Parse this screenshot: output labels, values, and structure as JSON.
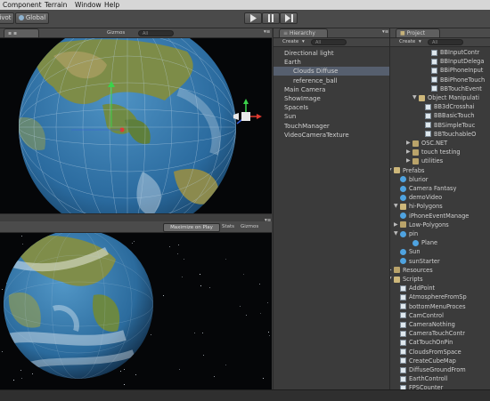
{
  "menubar": {
    "items": [
      "Component",
      "Terrain",
      "Window",
      "Help"
    ]
  },
  "toolbar": {
    "left_buttons": [
      "ivot",
      "Global"
    ],
    "play_icon": "play-icon",
    "pause_icon": "pause-icon",
    "step_icon": "step-icon"
  },
  "scene_panel": {
    "gizmos_label": "Gizmos",
    "search_placeholder": "All"
  },
  "game_panel": {
    "maximize_label": "Maximize on Play",
    "stats_label": "Stats",
    "gizmos_label": "Gizmos"
  },
  "hierarchy": {
    "tab_label": "Hierarchy",
    "create_label": "Create",
    "search_placeholder": "All",
    "items": [
      {
        "label": "Directional light",
        "indent": 0
      },
      {
        "label": "Earth",
        "indent": 0
      },
      {
        "label": "Clouds Diffuse",
        "indent": 1,
        "selected": true
      },
      {
        "label": "reference_ball",
        "indent": 1
      },
      {
        "label": "Main Camera",
        "indent": 0
      },
      {
        "label": "ShowImage",
        "indent": 0
      },
      {
        "label": "SpaceIs",
        "indent": 0
      },
      {
        "label": "Sun",
        "indent": 0
      },
      {
        "label": "TouchManager",
        "indent": 0
      },
      {
        "label": "VideoCameraTexture",
        "indent": 0
      }
    ]
  },
  "project": {
    "tab_label": "Project",
    "create_label": "Create",
    "search_placeholder": "All",
    "rows": [
      {
        "label": "BBInputContr",
        "indent": 6,
        "icon": "script"
      },
      {
        "label": "BBInputDelega",
        "indent": 6,
        "icon": "script"
      },
      {
        "label": "BBiPhoneInput",
        "indent": 6,
        "icon": "script"
      },
      {
        "label": "BBiPhoneTouch",
        "indent": 6,
        "icon": "script"
      },
      {
        "label": "BBTouchEvent",
        "indent": 6,
        "icon": "script"
      },
      {
        "label": "Object Manipulati",
        "indent": 4,
        "icon": "folder-open",
        "arrow": "▼"
      },
      {
        "label": "BB3dCrosshai",
        "indent": 5,
        "icon": "script"
      },
      {
        "label": "BBBasicTouch",
        "indent": 5,
        "icon": "script"
      },
      {
        "label": "BBSimpleTouc",
        "indent": 5,
        "icon": "script"
      },
      {
        "label": "BBTouchableO",
        "indent": 5,
        "icon": "script"
      },
      {
        "label": "OSC.NET",
        "indent": 3,
        "icon": "folder",
        "arrow": "▶"
      },
      {
        "label": "touch testing",
        "indent": 3,
        "icon": "folder",
        "arrow": "▶"
      },
      {
        "label": "utilities",
        "indent": 3,
        "icon": "folder",
        "arrow": "▶"
      },
      {
        "label": "Prefabs",
        "indent": 0,
        "icon": "folder-open",
        "arrow": "▼"
      },
      {
        "label": "blurior",
        "indent": 1,
        "icon": "prefab"
      },
      {
        "label": "Camera Fantasy",
        "indent": 1,
        "icon": "prefab"
      },
      {
        "label": "demoVideo",
        "indent": 1,
        "icon": "prefab"
      },
      {
        "label": "hi-Polygons",
        "indent": 1,
        "icon": "folder-open",
        "arrow": "▼"
      },
      {
        "label": "iPhoneEventManage",
        "indent": 1,
        "icon": "prefab"
      },
      {
        "label": "Low-Polygons",
        "indent": 1,
        "icon": "folder",
        "arrow": "▶"
      },
      {
        "label": "pin",
        "indent": 1,
        "icon": "prefab",
        "arrow": "▼"
      },
      {
        "label": "Plane",
        "indent": 3,
        "icon": "prefab"
      },
      {
        "label": "Sun",
        "indent": 1,
        "icon": "prefab"
      },
      {
        "label": "sunStarter",
        "indent": 1,
        "icon": "prefab"
      },
      {
        "label": "Resources",
        "indent": 0,
        "icon": "folder",
        "arrow": "▶"
      },
      {
        "label": "Scripts",
        "indent": 0,
        "icon": "folder-open",
        "arrow": "▼"
      },
      {
        "label": "AddPoint",
        "indent": 1,
        "icon": "script"
      },
      {
        "label": "AtmosphereFromSp",
        "indent": 1,
        "icon": "script"
      },
      {
        "label": "bottomMenuProces",
        "indent": 1,
        "icon": "script"
      },
      {
        "label": "CamControl",
        "indent": 1,
        "icon": "script"
      },
      {
        "label": "CameraNothing",
        "indent": 1,
        "icon": "script"
      },
      {
        "label": "CameraTouchContr",
        "indent": 1,
        "icon": "script"
      },
      {
        "label": "CatTouchOnPin",
        "indent": 1,
        "icon": "script"
      },
      {
        "label": "CloudsFromSpace",
        "indent": 1,
        "icon": "script"
      },
      {
        "label": "CreateCubeMap",
        "indent": 1,
        "icon": "script"
      },
      {
        "label": "DiffuseGroundFrom",
        "indent": 1,
        "icon": "script"
      },
      {
        "label": "EarthControll",
        "indent": 1,
        "icon": "script"
      },
      {
        "label": "FPSCounter",
        "indent": 1,
        "icon": "script"
      }
    ]
  },
  "colors": {
    "space": "#050608",
    "ocean": "#2f74a8",
    "land": "#7a8a45",
    "selection": "#565f6e",
    "panel": "#3b3b3b"
  }
}
